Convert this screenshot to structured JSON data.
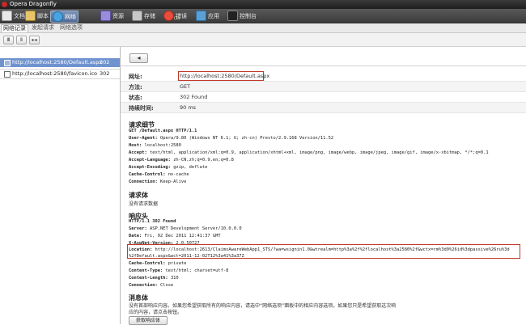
{
  "window": {
    "title": "Opera Dragonfly"
  },
  "toolbar": {
    "items": [
      {
        "label": "文档",
        "icon": "document-icon"
      },
      {
        "label": "脚本",
        "icon": "script-icon"
      },
      {
        "label": "网络",
        "icon": "network-icon",
        "active": true
      },
      {
        "label": "资源",
        "icon": "resources-icon"
      },
      {
        "label": "存储",
        "icon": "storage-icon"
      },
      {
        "label": "错误",
        "badge": "(1)",
        "icon": "error-icon"
      },
      {
        "label": "应用",
        "icon": "utilities-icon"
      },
      {
        "label": "控制台",
        "icon": "console-icon"
      }
    ]
  },
  "subtabs": [
    {
      "label": "网络记录",
      "active": true
    },
    {
      "label": "发起请求"
    },
    {
      "label": "网络选项"
    }
  ],
  "controls": {
    "clear": "Ⅲ",
    "pause": "Ⅱ",
    "expand": "▸◂"
  },
  "requests": [
    {
      "url": "http://localhost:2580/Default.aspx",
      "status": "302",
      "selected": true
    },
    {
      "url": "http://localhost:2580/favicon.ico",
      "status": "302",
      "selected": false
    }
  ],
  "detail": {
    "back": "◂",
    "url_label": "网址:",
    "url_value": "http://localhost:2580/Default.aspx",
    "method_label": "方法:",
    "method_value": "GET",
    "status_label": "状态:",
    "status_value": "302 Found",
    "duration_label": "持续时间:",
    "duration_value": "90 ms",
    "request_details_title": "请求细节",
    "request_lines": [
      {
        "k": "",
        "v": "GET /Default.aspx HTTP/1.1"
      },
      {
        "k": "User-Agent: ",
        "v": "Opera/9.80 (Windows NT 6.1; U; zh-cn) Presto/2.9.168 Version/11.52"
      },
      {
        "k": "Host: ",
        "v": "localhost:2580"
      },
      {
        "k": "Accept: ",
        "v": "text/html, application/xml;q=0.9, application/xhtml+xml, image/png, image/webp, image/jpeg, image/gif, image/x-xbitmap, */*;q=0.1"
      },
      {
        "k": "Accept-Language: ",
        "v": "zh-CN,zh;q=0.9,en;q=0.8"
      },
      {
        "k": "Accept-Encoding: ",
        "v": "gzip, deflate"
      },
      {
        "k": "Cache-Control: ",
        "v": "no-cache"
      },
      {
        "k": "Connection: ",
        "v": "Keep-Alive"
      }
    ],
    "request_body_title": "请求体",
    "request_body_text": "没有请求数据",
    "response_headers_title": "响应头",
    "response_lines": [
      {
        "k": "",
        "v": "HTTP/1.1 302 Found"
      },
      {
        "k": "Server: ",
        "v": "ASP.NET Development Server/10.0.0.0"
      },
      {
        "k": "Date: ",
        "v": "Fri, 02 Dec 2011 12:41:37 GMT"
      },
      {
        "k": "X-AspNet-Version: ",
        "v": "2.0.50727"
      }
    ],
    "location_key": "Location: ",
    "location_line1": "http://localhost:2613/ClaimsAwareWebApp1_STS/?wa=wsignin1.0&wtrealm=http%3a%2f%2flocalhost%3a2580%2f&wctx=rm%3d0%26id%3dpassive%26ru%3d",
    "location_line2": "%2fDefault.aspx&wct=2011-12-02T12%3a41%3a37Z",
    "response_lines2": [
      {
        "k": "Cache-Control: ",
        "v": "private"
      },
      {
        "k": "Content-Type: ",
        "v": "text/html; charset=utf-8"
      },
      {
        "k": "Content-Length: ",
        "v": "310"
      },
      {
        "k": "Connection: ",
        "v": "Close"
      }
    ],
    "message_body_title": "消息体",
    "message_body_line1": "没有首部响应内容。如果您希望获取所有的响应内容，请选中“网络选项”面板中的相应内容选项。如果您只是希望获取这次响",
    "message_body_line2": "应的内容，请点击按钮。",
    "get_body_button": "获取响应体"
  }
}
